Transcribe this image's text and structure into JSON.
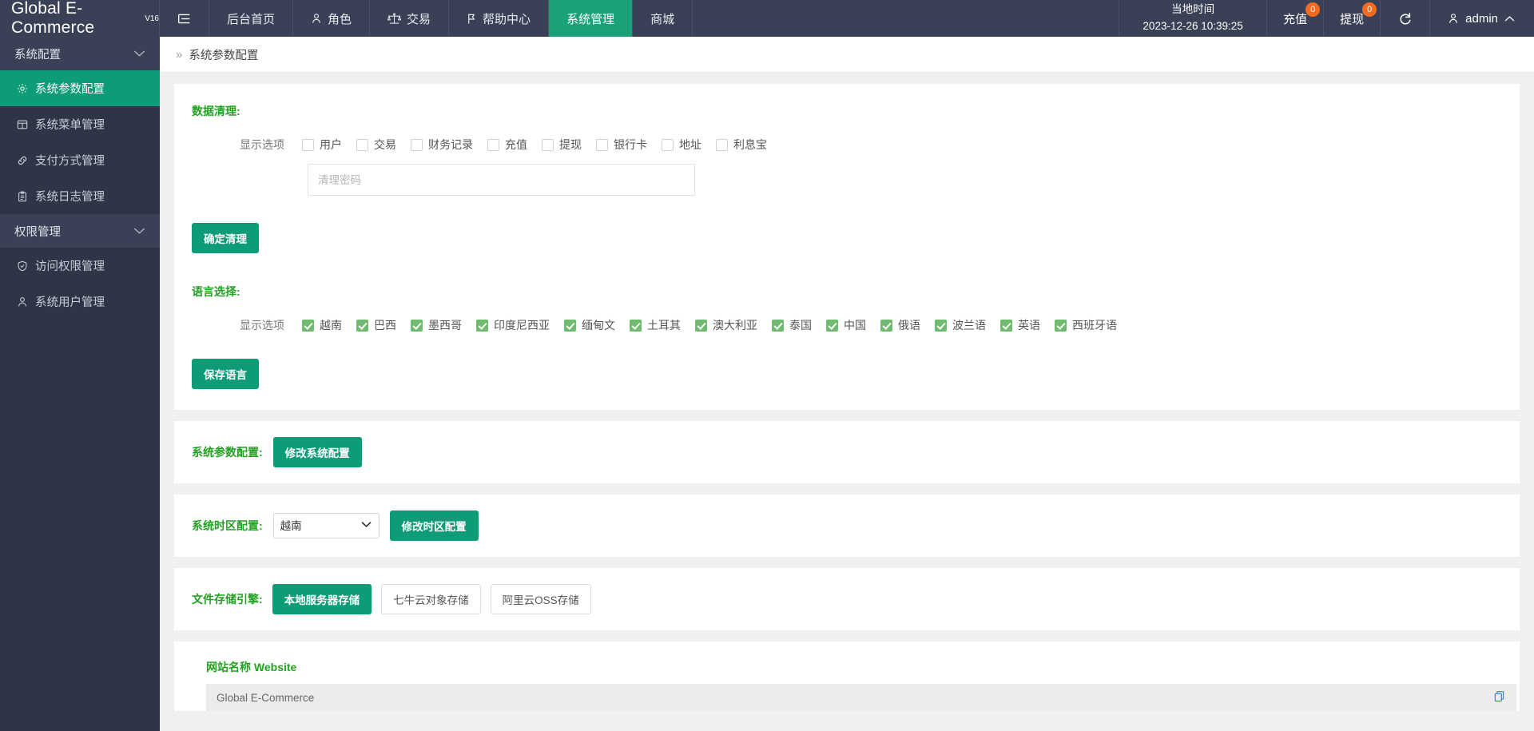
{
  "topbar": {
    "brand": "Global E-Commerce",
    "brand_version": "V16",
    "hamburger_icon": "menu-icon",
    "nav": [
      {
        "label": "后台首页",
        "icon": "",
        "active": false
      },
      {
        "label": "角色",
        "icon": "user-icon",
        "active": false
      },
      {
        "label": "交易",
        "icon": "scales-icon",
        "active": false
      },
      {
        "label": "帮助中心",
        "icon": "flag-icon",
        "active": false
      },
      {
        "label": "系统管理",
        "icon": "",
        "active": true
      },
      {
        "label": "商城",
        "icon": "",
        "active": false
      }
    ],
    "localtime_label": "当地时间",
    "localtime_value": "2023-12-26 10:39:25",
    "recharge_label": "充值",
    "recharge_badge": "0",
    "withdraw_label": "提现",
    "withdraw_badge": "0",
    "refresh_icon": "refresh-icon",
    "user_icon": "user-icon",
    "user_name": "admin",
    "user_chevron": "chevron-up-icon",
    "accent_active": "#1aa179",
    "badge_color": "#f56a1f",
    "bg": "#3a4055"
  },
  "sidebar": {
    "groups": [
      {
        "label": "系统配置",
        "chevron": "chevron-down-icon",
        "items": [
          {
            "label": "系统参数配置",
            "icon": "gear-icon",
            "active": true
          },
          {
            "label": "系统菜单管理",
            "icon": "window-icon",
            "active": false
          },
          {
            "label": "支付方式管理",
            "icon": "link-icon",
            "active": false
          },
          {
            "label": "系统日志管理",
            "icon": "clipboard-icon",
            "active": false
          }
        ]
      },
      {
        "label": "权限管理",
        "chevron": "chevron-down-icon",
        "items": [
          {
            "label": "访问权限管理",
            "icon": "shield-check-icon",
            "active": false
          },
          {
            "label": "系统用户管理",
            "icon": "person-icon",
            "active": false
          }
        ]
      }
    ],
    "bg": "#2f3446",
    "active_color": "#0d9b78"
  },
  "breadcrumb": {
    "arrows": "»",
    "current": "系统参数配置"
  },
  "data_cleanup": {
    "title": "数据清理:",
    "options_label": "显示选项",
    "options": [
      {
        "label": "用户",
        "checked": false
      },
      {
        "label": "交易",
        "checked": false
      },
      {
        "label": "财务记录",
        "checked": false
      },
      {
        "label": "充值",
        "checked": false
      },
      {
        "label": "提现",
        "checked": false
      },
      {
        "label": "银行卡",
        "checked": false
      },
      {
        "label": "地址",
        "checked": false
      },
      {
        "label": "利息宝",
        "checked": false
      }
    ],
    "password_placeholder": "清理密码",
    "password_value": "",
    "confirm_button": "确定清理"
  },
  "language": {
    "title": "语言选择:",
    "options_label": "显示选项",
    "options": [
      {
        "label": "越南",
        "checked": true
      },
      {
        "label": "巴西",
        "checked": true
      },
      {
        "label": "墨西哥",
        "checked": true
      },
      {
        "label": "印度尼西亚",
        "checked": true
      },
      {
        "label": "缅甸文",
        "checked": true
      },
      {
        "label": "土耳其",
        "checked": true
      },
      {
        "label": "澳大利亚",
        "checked": true
      },
      {
        "label": "泰国",
        "checked": true
      },
      {
        "label": "中国",
        "checked": true
      },
      {
        "label": "俄语",
        "checked": true
      },
      {
        "label": "波兰语",
        "checked": true
      },
      {
        "label": "英语",
        "checked": true
      },
      {
        "label": "西班牙语",
        "checked": true
      }
    ],
    "save_button": "保存语言"
  },
  "sys_params": {
    "label": "系统参数配置:",
    "button": "修改系统配置"
  },
  "timezone": {
    "label": "系统时区配置:",
    "selected": "越南",
    "options": [
      "越南"
    ],
    "chevron": "chevron-down-icon",
    "button": "修改时区配置"
  },
  "storage": {
    "label": "文件存储引擎:",
    "buttons": [
      {
        "label": "本地服务器存储",
        "active": true
      },
      {
        "label": "七牛云对象存储",
        "active": false
      },
      {
        "label": "阿里云OSS存储",
        "active": false
      }
    ]
  },
  "website": {
    "label": "网站名称 Website",
    "value": "Global E-Commerce",
    "copy_icon": "copy-icon"
  },
  "colors": {
    "green_heading": "#22a122",
    "teal": "#0d9b78",
    "checkbox_green": "#6fba6f"
  }
}
